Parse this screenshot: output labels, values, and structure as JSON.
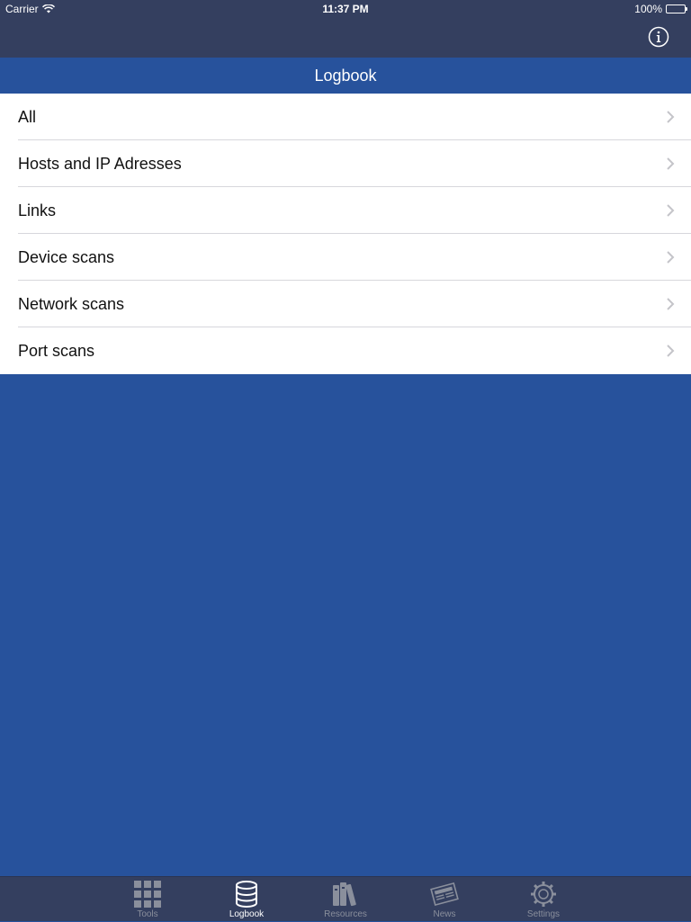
{
  "status_bar": {
    "carrier": "Carrier",
    "time": "11:37 PM",
    "battery": "100%"
  },
  "nav_bar": {
    "info_icon": "info-icon"
  },
  "header": {
    "title": "Logbook"
  },
  "list": {
    "items": [
      {
        "label": "All"
      },
      {
        "label": "Hosts and IP Adresses"
      },
      {
        "label": "Links"
      },
      {
        "label": "Device scans"
      },
      {
        "label": "Network scans"
      },
      {
        "label": "Port scans"
      }
    ]
  },
  "tab_bar": {
    "tabs": [
      {
        "label": "Tools",
        "icon": "grid-icon"
      },
      {
        "label": "Logbook",
        "icon": "database-icon",
        "active": true
      },
      {
        "label": "Resources",
        "icon": "books-icon"
      },
      {
        "label": "News",
        "icon": "newspaper-icon"
      },
      {
        "label": "Settings",
        "icon": "gear-icon"
      }
    ]
  },
  "colors": {
    "bar_background": "#343f5f",
    "accent_blue": "#27529c",
    "inactive_tab": "#8a8f9c",
    "active_tab": "#ffffff"
  }
}
